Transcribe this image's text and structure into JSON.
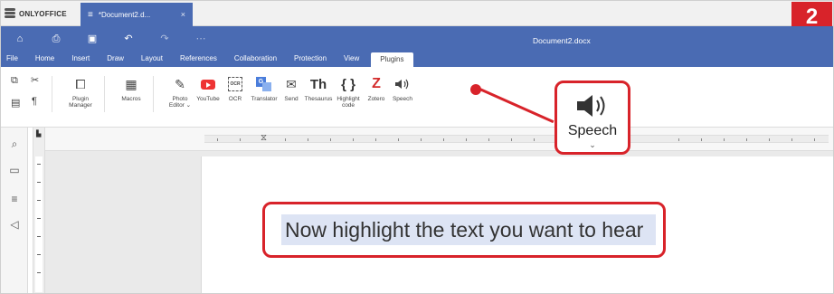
{
  "app": {
    "brand": "ONLYOFFICE",
    "doc_tab": "*Document2.d...",
    "doc_tab_close": "×",
    "doc_title": "Document2.docx"
  },
  "badge": "2",
  "menu": [
    "File",
    "Home",
    "Insert",
    "Draw",
    "Layout",
    "References",
    "Collaboration",
    "Protection",
    "View",
    "Plugins"
  ],
  "active_tab": "Plugins",
  "toolbar": {
    "plugin_manager": "Plugin\nManager",
    "macros": "Macros",
    "photo_editor": "Photo\nEditor ⌄",
    "youtube": "YouTube",
    "ocr": "OCR",
    "translator": "Translator",
    "send": "Send",
    "thesaurus": "Thesaurus",
    "highlight_code": "Highlight\ncode",
    "zotero": "Zotero",
    "speech": "Speech"
  },
  "callout": {
    "label": "Speech"
  },
  "instruction": "Now highlight the text you want to hear",
  "colors": {
    "header_blue": "#4a6bb3",
    "annotation_red": "#d8232a",
    "highlight": "#dde4f4"
  }
}
